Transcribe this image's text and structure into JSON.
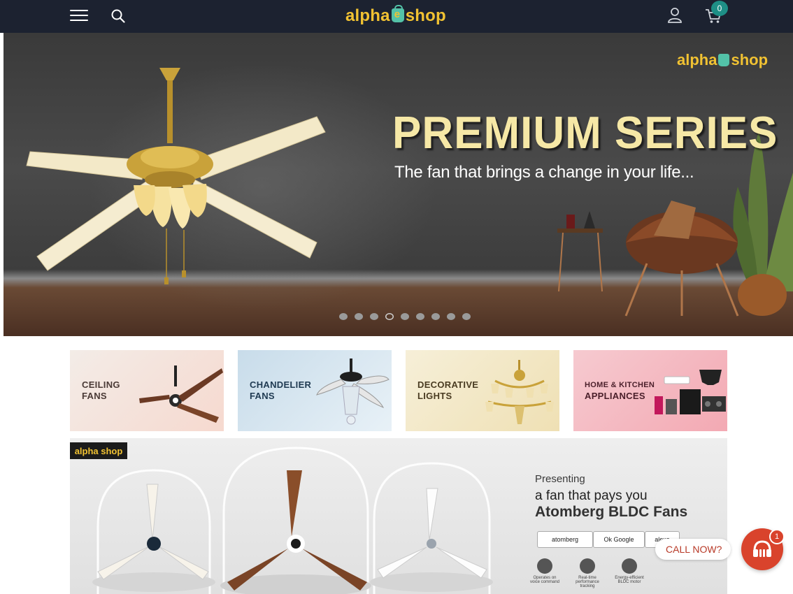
{
  "header": {
    "logo_text_left": "alpha",
    "logo_text_right": "shop",
    "cart_count": "0",
    "icons": [
      "menu-icon",
      "search-icon",
      "user-icon",
      "cart-icon"
    ],
    "background_color": "#1c2230",
    "accent_color": "#f1c232"
  },
  "hero": {
    "logo_text_left": "alpha",
    "logo_text_right": "shop",
    "title": "PREMIUM SERIES",
    "subtitle": "The fan that brings a change in your life...",
    "slide_count": 9,
    "active_slide": 4
  },
  "categories": [
    {
      "line1": "CEILING",
      "line2": "FANS"
    },
    {
      "line1": "CHANDELIER",
      "line2": "FANS"
    },
    {
      "line1": "DECORATIVE",
      "line2": "LIGHTS"
    },
    {
      "line1": "HOME & KITCHEN",
      "line2": "APPLIANCES"
    }
  ],
  "banner": {
    "logo_text": "alpha shop",
    "presenting": "Presenting",
    "tagline": "a fan that pays you",
    "headline": "Atomberg BLDC Fans",
    "badges": [
      "atomberg",
      "Ok Google",
      "alexa"
    ],
    "features": [
      "Operates on voice command",
      "Real-time performance tracking",
      "Energy-efficient BLDC motor"
    ]
  },
  "call_widget": {
    "label": "CALL NOW?",
    "badge_count": "1",
    "color": "#d9432c"
  }
}
